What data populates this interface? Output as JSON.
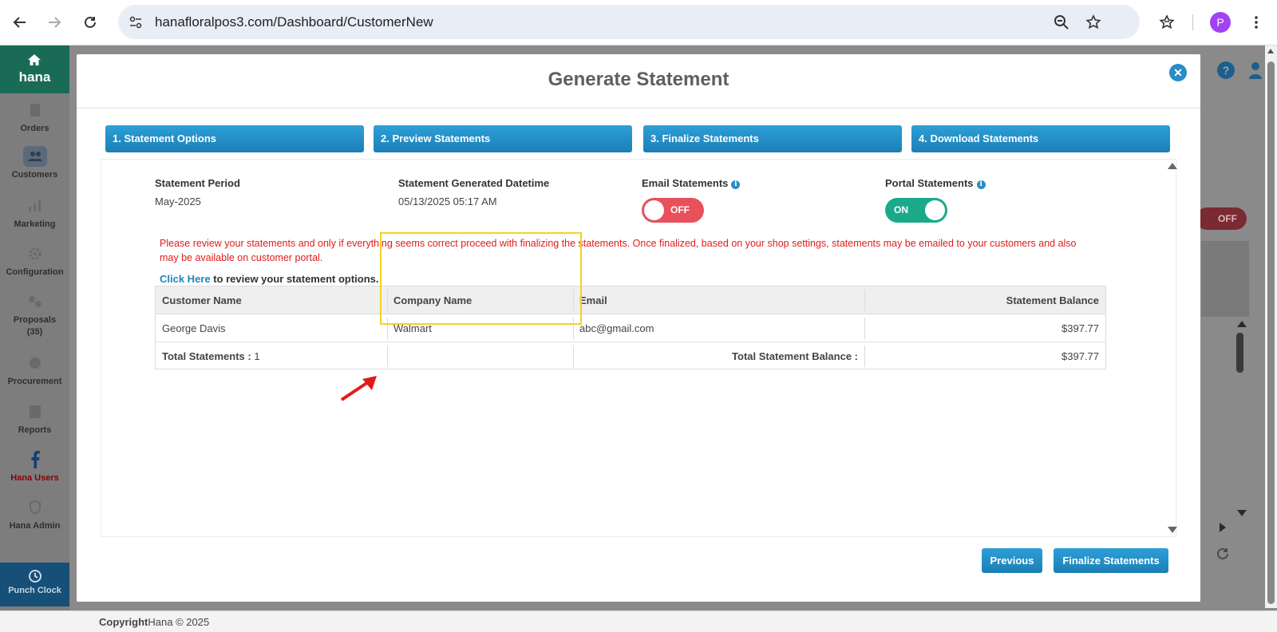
{
  "browser": {
    "url": "hanafloralpos3.com/Dashboard/CustomerNew",
    "profile_initial": "P"
  },
  "sidebar": {
    "brand": "hana",
    "items": [
      {
        "label": "Orders"
      },
      {
        "label": "Customers"
      },
      {
        "label": "Marketing"
      },
      {
        "label": "Configuration"
      },
      {
        "label": "Proposals",
        "sub": "(35)"
      },
      {
        "label": "Procurement"
      },
      {
        "label": "Reports"
      },
      {
        "label": "Hana Users"
      },
      {
        "label": "Hana Admin"
      }
    ],
    "punch_clock": "Punch Clock"
  },
  "background": {
    "off_toggle": "OFF"
  },
  "footer": {
    "copyright_bold": "Copyright",
    "copyright_rest": "Hana © 2025"
  },
  "modal": {
    "title": "Generate Statement",
    "steps": [
      "1. Statement Options",
      "2. Preview Statements",
      "3. Finalize Statements",
      "4. Download Statements"
    ],
    "statement_period_label": "Statement Period",
    "statement_period_value": "May-2025",
    "generated_label": "Statement Generated Datetime",
    "generated_value": "05/13/2025 05:17 AM",
    "email_label": "Email Statements",
    "email_toggle": "OFF",
    "portal_label": "Portal Statements",
    "portal_toggle": "ON",
    "warning": "Please review your statements and only if everything seems correct proceed with finalizing the statements. Once finalized, based on your shop settings, statements may be emailed to your customers and also may be available on customer portal.",
    "click_here": "Click Here",
    "click_rest": " to review your statement options.",
    "table": {
      "headers": [
        "Customer Name",
        "Company Name",
        "Email",
        "Statement Balance"
      ],
      "rows": [
        [
          "George Davis",
          "Walmart",
          "abc@gmail.com",
          "$397.77"
        ]
      ],
      "total_label": "Total Statements :",
      "total_count": "1",
      "total_balance_label": "Total Statement Balance :",
      "total_balance": "$397.77"
    },
    "previous_button": "Previous",
    "finalize_button": "Finalize Statements"
  },
  "colors": {
    "accent": "#1f86c4",
    "toggle_off": "#e8505b",
    "toggle_on": "#1aaa8a",
    "warning": "#e21b1b",
    "highlight": "#f5d223",
    "annotation_arrow": "#e01b1b"
  }
}
